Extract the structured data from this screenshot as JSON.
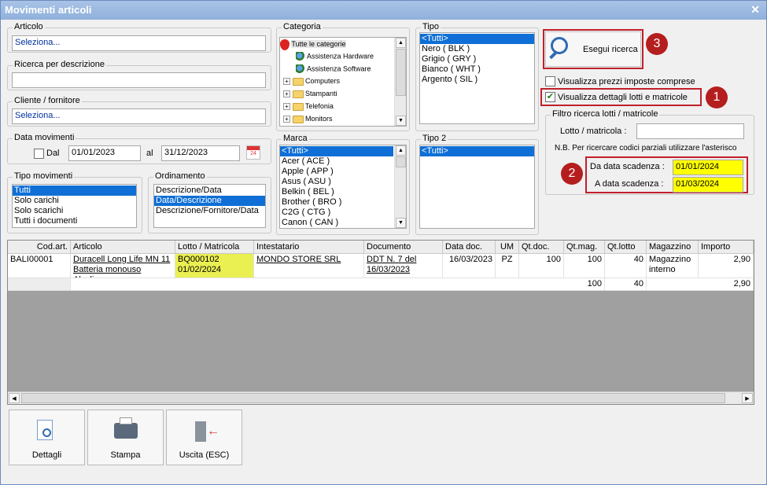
{
  "window": {
    "title": "Movimenti articoli",
    "close": "✕"
  },
  "articolo": {
    "label": "Articolo",
    "value": "Seleziona..."
  },
  "ricerca": {
    "label": "Ricerca per descrizione",
    "value": ""
  },
  "cliente": {
    "label": "Cliente / fornitore",
    "value": "Seleziona..."
  },
  "data_movimenti": {
    "label": "Data movimenti",
    "dal_label": "Dal",
    "dal_value": "01/01/2023",
    "al_label": "al",
    "al_value": "31/12/2023",
    "cal_text": "24"
  },
  "tipo_movimenti": {
    "label": "Tipo movimenti",
    "items": [
      "Tutti",
      "Solo carichi",
      "Solo scarichi",
      "Tutti i documenti"
    ]
  },
  "ordinamento": {
    "label": "Ordinamento",
    "items": [
      "Descrizione/Data",
      "Data/Descrizione",
      "Descrizione/Fornitore/Data"
    ]
  },
  "categoria": {
    "label": "Categoria",
    "root": "Tutte le categorie",
    "items": [
      "Assistenza Hardware",
      "Assistenza Software",
      "Computers",
      "Stampanti",
      "Telefonia",
      "Monitors"
    ]
  },
  "marca": {
    "label": "Marca",
    "items": [
      "<Tutti>",
      "Acer ( ACE )",
      "Apple ( APP )",
      "Asus ( ASU )",
      "Belkin ( BEL )",
      "Brother ( BRO )",
      "C2G ( CTG )",
      "Canon ( CAN )"
    ]
  },
  "tipo": {
    "label": "Tipo",
    "items": [
      "<Tutti>",
      "Nero ( BLK )",
      "Grigio ( GRY )",
      "Bianco ( WHT )",
      "Argento ( SIL )"
    ]
  },
  "tipo2": {
    "label": "Tipo 2",
    "items": [
      "<Tutti>"
    ]
  },
  "esegui": {
    "label": "Esegui ricerca"
  },
  "markers": {
    "m1": "1",
    "m2": "2",
    "m3": "3"
  },
  "options": {
    "prezzi": "Visualizza prezzi imposte comprese",
    "dettagli": "Visualizza dettagli lotti e matricole",
    "dettagli_check": "✔"
  },
  "filtro": {
    "label": "Filtro ricerca lotti / matricole",
    "lotto_label": "Lotto / matricola :",
    "lotto_value": "",
    "note": "N.B. Per ricercare codici parziali utilizzare l'asterisco",
    "da_label": "Da data scadenza :",
    "da_value": "01/01/2024",
    "a_label": "A data scadenza :",
    "a_value": "01/03/2024"
  },
  "grid": {
    "headers": [
      "Cod.art.",
      "Articolo",
      "Lotto / Matricola",
      "Intestatario",
      "Documento",
      "Data doc.",
      "UM",
      "Qt.doc.",
      "Qt.mag.",
      "Qt.lotto",
      "Magazzino",
      "Importo"
    ],
    "row": {
      "cod": "BALI00001",
      "articolo1": "Duracell Long Life MN 11",
      "articolo2": "Batteria monouso Alcalino",
      "lotto1": "BQ000102",
      "lotto2": "01/02/2024",
      "intestatario": "MONDO STORE SRL",
      "doc1": "DDT N. 7 del",
      "doc2": "16/03/2023",
      "data": "16/03/2023",
      "um": "PZ",
      "qtdoc": "100",
      "qtmag": "100",
      "qtlotto": "40",
      "mag1": "Magazzino",
      "mag2": "interno",
      "importo": "2,90"
    },
    "totals": {
      "qtmag": "100",
      "qtlotto": "40",
      "importo": "2,90"
    }
  },
  "buttons": {
    "dettagli": "Dettagli",
    "stampa": "Stampa",
    "uscita": "Uscita (ESC)"
  }
}
